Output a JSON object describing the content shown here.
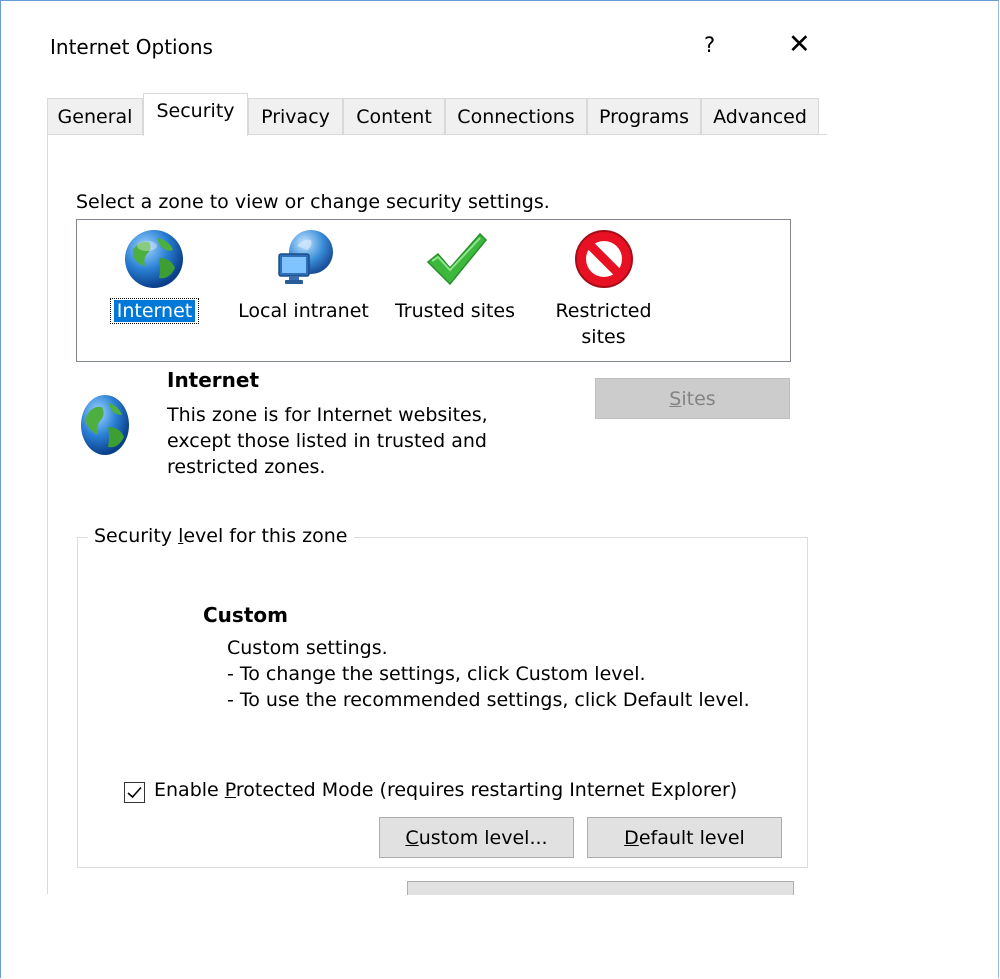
{
  "window": {
    "title": "Internet Options",
    "help_label": "?",
    "close_label": "✕"
  },
  "tabs": [
    {
      "label": "General"
    },
    {
      "label": "Security",
      "active": true
    },
    {
      "label": "Privacy"
    },
    {
      "label": "Content"
    },
    {
      "label": "Connections"
    },
    {
      "label": "Programs"
    },
    {
      "label": "Advanced"
    }
  ],
  "zones": {
    "prompt": "Select a zone to view or change security settings.",
    "items": [
      {
        "label": "Internet",
        "icon": "globe-icon",
        "selected": true
      },
      {
        "label": "Local intranet",
        "icon": "intranet-globe-icon"
      },
      {
        "label": "Trusted sites",
        "icon": "checkmark-icon"
      },
      {
        "label_line1": "Restricted",
        "label_line2": "sites",
        "icon": "restricted-icon"
      }
    ]
  },
  "zone_info": {
    "title": "Internet",
    "description": "This zone is for Internet websites, except those listed in trusted and restricted zones.",
    "sites_button_accel": "S",
    "sites_button_rest": "ites"
  },
  "security_level": {
    "group_label_pre": "Security ",
    "group_label_accel": "l",
    "group_label_post": "evel for this zone",
    "level_title": "Custom",
    "desc_lines": [
      "Custom settings.",
      "- To change the settings, click Custom level.",
      "- To use the recommended settings, click Default level."
    ],
    "protected_mode_pre": "Enable ",
    "protected_mode_accel": "P",
    "protected_mode_post": "rotected Mode (requires restarting Internet Explorer)",
    "protected_mode_checked": true,
    "custom_button_accel": "C",
    "custom_button_rest": "ustom level...",
    "default_button_accel": "D",
    "default_button_rest": "efault level"
  },
  "colors": {
    "selection": "#0078d7",
    "button_bg": "#e1e1e1",
    "disabled_button_bg": "#cccccc",
    "error_red": "#e81123",
    "check_green": "#3cb93c"
  }
}
